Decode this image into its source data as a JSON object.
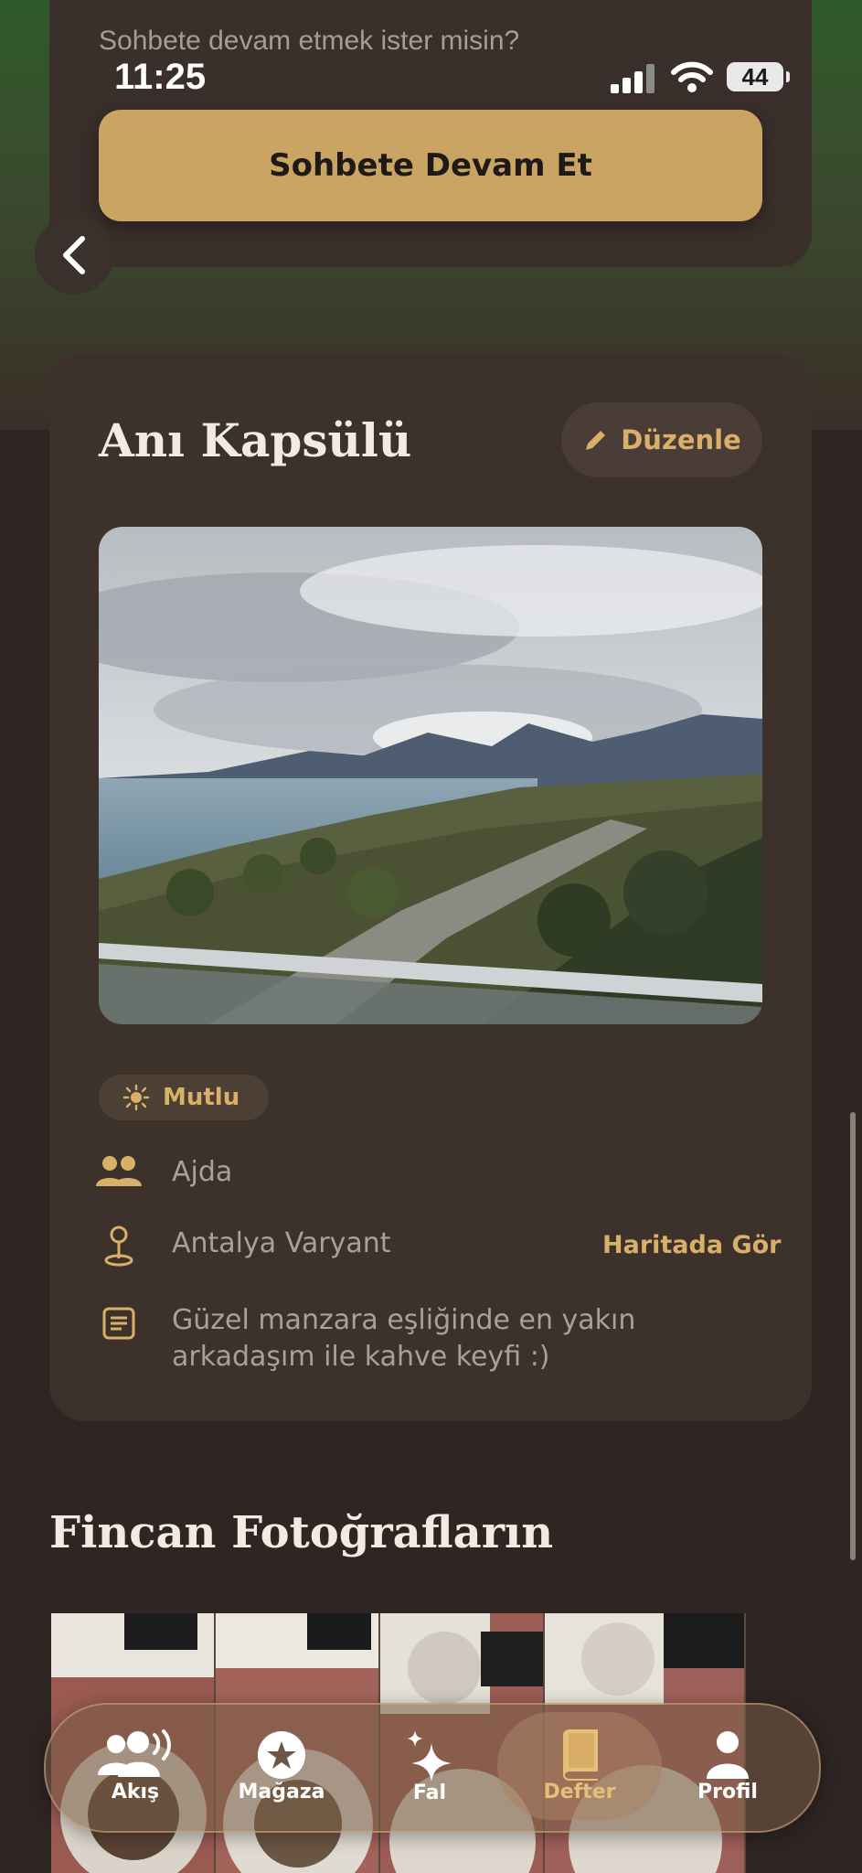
{
  "status_bar": {
    "time": "11:25",
    "battery": "44"
  },
  "chat_card": {
    "prompt": "Sohbete devam etmek ister misin?",
    "continue_label": "Sohbete Devam Et"
  },
  "memory_capsule": {
    "title": "Anı Kapsülü",
    "edit_label": "Düzenle",
    "mood": "Mutlu",
    "people": "Ajda",
    "location": "Antalya Varyant",
    "map_link": "Haritada Gör",
    "note_line1": "Güzel manzara eşliğinde en yakın",
    "note_line2": "arkadaşım ile kahve keyfi :)"
  },
  "cup_photos": {
    "title": "Fincan Fotoğrafların"
  },
  "tab_bar": {
    "items": [
      {
        "label": "Akış",
        "icon": "people-broadcast-icon"
      },
      {
        "label": "Mağaza",
        "icon": "star-circle-icon"
      },
      {
        "label": "Fal",
        "icon": "sparkles-icon"
      },
      {
        "label": "Defter",
        "icon": "book-icon",
        "active": true
      },
      {
        "label": "Profil",
        "icon": "person-icon"
      }
    ]
  },
  "colors": {
    "accent": "#c9a462",
    "background": "#2f2523",
    "card": "#3d312c"
  }
}
